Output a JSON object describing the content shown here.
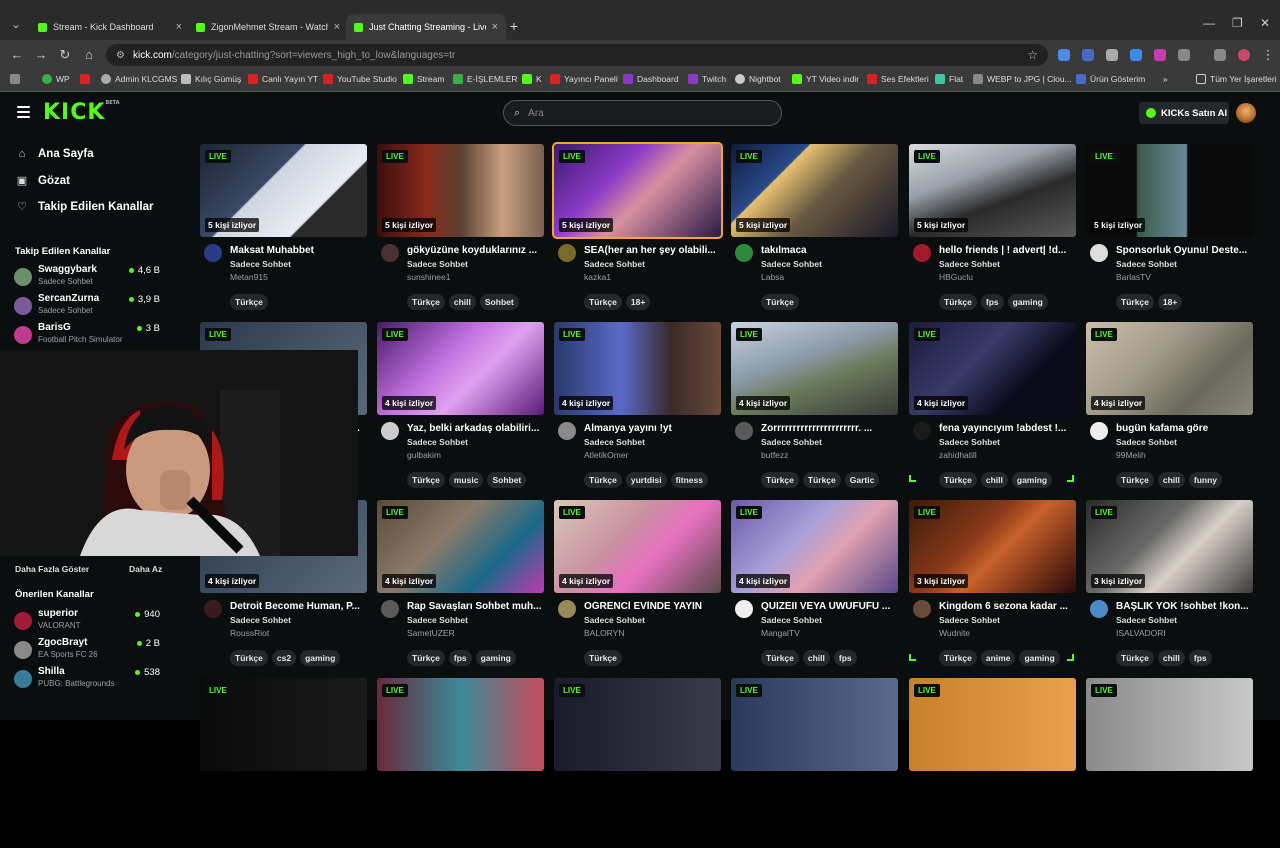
{
  "browser": {
    "tabs": [
      {
        "title": "Stream - Kick Dashboard"
      },
      {
        "title": "ZigonMehmet Stream - Watch"
      },
      {
        "title": "Just Chatting Streaming - Live"
      }
    ],
    "url_host": "kick.com",
    "url_path": "/category/just-chatting?sort=viewers_high_to_low&languages=tr",
    "bookmarks": [
      "WP",
      "Admin KLCGMS",
      "Kılıç Gümüş",
      "Canlı Yayın YT",
      "YouTube Studio",
      "Stream",
      "E-İŞLEMLER",
      "K",
      "Yayıncı Paneli",
      "Dashboard",
      "Twitch",
      "Nightbot",
      "YT Video indir",
      "Ses Efektleri",
      "Flat",
      "WEBP to JPG | Clou...",
      "Ürün Gösterim"
    ],
    "bookmarks_folder": "Tüm Yer İşaretleri"
  },
  "header": {
    "logo": "KICK",
    "logo_badge": "BETA",
    "search_placeholder": "Ara",
    "buy_label": "KICKs Satın Al"
  },
  "sidebar": {
    "nav": [
      "Ana Sayfa",
      "Gözat",
      "Takip Edilen Kanallar"
    ],
    "followed_heading": "Takip Edilen Kanallar",
    "followed": [
      {
        "name": "Swaggybark",
        "sub": "Sadece Sohbet",
        "viewers": "4,6 B",
        "color": "#6a8f6a"
      },
      {
        "name": "SercanZurna",
        "sub": "Sadece Sohbet",
        "viewers": "3,9 B",
        "color": "#7a5a9a"
      },
      {
        "name": "BarisG",
        "sub": "Football Pitch Simulator",
        "viewers": "3 B",
        "color": "#c23b8a"
      }
    ],
    "show_more": "Daha Fazla Göster",
    "show_less": "Daha Az",
    "recommended_heading": "Önerilen Kanallar",
    "recommended": [
      {
        "name": "superior",
        "sub": "VALORANT",
        "viewers": "940",
        "color": "#a01a3a"
      },
      {
        "name": "ZgocBrayt",
        "sub": "EA Sports FC 26",
        "viewers": "2 B",
        "color": "#888"
      },
      {
        "name": "Shilla",
        "sub": "PUBG: Battlegrounds",
        "viewers": "538",
        "color": "#3a7a9a"
      }
    ]
  },
  "live_label": "LIVE",
  "cards": [
    {
      "viewers": "5 kişi izliyor",
      "title": "Maksat Muhabbet",
      "category": "Sadece Sohbet",
      "channel": "Metan915",
      "tags": [
        "Türkçe"
      ],
      "thumb": "linear-gradient(135deg,#1c2430,#3a4a66 40%,#cfd6e0 41%,#e8ecf2 70%,#2a2a2a 71%)",
      "avatar": "#2a3a8a"
    },
    {
      "viewers": "5 kişi izliyor",
      "title": "gökyüzüne koyduklarınız ...",
      "category": "Sadece Sohbet",
      "channel": "sunshinee1",
      "tags": [
        "Türkçe",
        "chill",
        "Sohbet"
      ],
      "thumb": "linear-gradient(90deg,#3a0e0e,#8a2a1a 30%,#5a4030 50%,#c8a080 75%,#7a6050)",
      "avatar": "#4a3030"
    },
    {
      "viewers": "5 kişi izliyor",
      "title": "SEA(her an her şey olabili...",
      "category": "Sadece Sohbet",
      "channel": "kazka1",
      "tags": [
        "Türkçe",
        "18+"
      ],
      "thumb": "linear-gradient(135deg,#3a1a6a,#8a3ac8 35%,#d890a0 55%,#2a1a4a)",
      "avatar": "#7a6a2a",
      "selected": true
    },
    {
      "viewers": "5 kişi izliyor",
      "title": "takılmaca",
      "category": "Sadece Sohbet",
      "channel": "Labsa",
      "tags": [
        "Türkçe"
      ],
      "thumb": "linear-gradient(135deg,#0e1a3a,#2a4a8a 30%,#e8c070 31%,#6a5a40 55%,#1a1a2a)",
      "avatar": "#2a8a3a"
    },
    {
      "viewers": "5 kişi izliyor",
      "title": "hello friends | ! advert| !d...",
      "category": "Sadece Sohbet",
      "channel": "HBGuclu",
      "tags": [
        "Türkçe",
        "fps",
        "gaming"
      ],
      "thumb": "linear-gradient(160deg,#d8dce0,#9aa0a8 35%,#2a2a2a 60%,#5a5a5a)",
      "avatar": "#a01a2a"
    },
    {
      "viewers": "5 kişi izliyor",
      "title": "Sponsorluk Oyunu! Deste...",
      "category": "Sadece Sohbet",
      "channel": "BarlasTV",
      "tags": [
        "Türkçe",
        "18+"
      ],
      "thumb": "linear-gradient(90deg,#0a0a0a 30%,#3a5a4a 31%,#6a8a9a 60%,#0a0a0a 61%)",
      "avatar": "#ddd"
    },
    {
      "viewers": "4 kişi izliyor",
      "title": "Detroit Become Human, P...",
      "category": "Sadece Sohbet",
      "channel": "RoussRiot",
      "tags": [
        "Türkçe",
        "cs2",
        "gaming"
      ],
      "thumb": "linear-gradient(135deg,#2a3a4a,#5a6a7a)",
      "avatar": "#3a1a1a"
    },
    {
      "viewers": "4 kişi izliyor",
      "title": "Yaz, belki arkadaş olabiliri...",
      "category": "Sadece Sohbet",
      "channel": "gulbakim",
      "tags": [
        "Türkçe",
        "music",
        "Sohbet"
      ],
      "thumb": "linear-gradient(135deg,#4a1a6a,#c070e0 40%,#e0a0f0 60%,#5a1a7a)",
      "avatar": "#ccc"
    },
    {
      "viewers": "4 kişi izliyor",
      "title": "Almanya yayını !yt",
      "category": "Sadece Sohbet",
      "channel": "AtletikOmer",
      "tags": [
        "Türkçe",
        "yurtdisi",
        "fitness"
      ],
      "thumb": "linear-gradient(90deg,#2a3a6a,#5a6ac8 40%,#3a2a2a 70%,#6a4a3a)",
      "avatar": "#8a8a8a"
    },
    {
      "viewers": "4 kişi izliyor",
      "title": "Zorrrrrrrrrrrrrrrrrrrrrr. ...",
      "category": "Sadece Sohbet",
      "channel": "butfezz",
      "tags": [
        "Türkçe",
        "Türkçe",
        "Gartic"
      ],
      "thumb": "linear-gradient(160deg,#c8d4e0,#8a9aa8 40%,#6a7a5a 60%,#3a3a3a)",
      "avatar": "#5a5a5a"
    },
    {
      "viewers": "4 kişi izliyor",
      "title": "fena yayıncıyım !abdest !...",
      "category": "Sadece Sohbet",
      "channel": "zahidhatill",
      "tags": [
        "Türkçe",
        "chill",
        "gaming"
      ],
      "thumb": "linear-gradient(135deg,#1a1a3a,#3a3a6a 40%,#0a0a1a 70%)",
      "avatar": "#1a1a1a"
    },
    {
      "viewers": "4 kişi izliyor",
      "title": "bugün kafama göre",
      "category": "Sadece Sohbet",
      "channel": "99Melih",
      "tags": [
        "Türkçe",
        "chill",
        "funny"
      ],
      "thumb": "linear-gradient(135deg,#c8c0a8,#a09a88 40%,#6a6a5a 70%,#8a8a7a)",
      "avatar": "#eee"
    },
    {
      "viewers": "4 kişi izliyor",
      "title": "Detroit Become Human, P...",
      "category": "Sadece Sohbet",
      "channel": "RoussRiot",
      "tags": [
        "Türkçe",
        "cs2",
        "gaming"
      ],
      "thumb": "linear-gradient(135deg,#2a3a4a,#5a6a7a)",
      "avatar": "#3a1a1a"
    },
    {
      "viewers": "4 kişi izliyor",
      "title": "Rap Savaşları Sohbet muh...",
      "category": "Sadece Sohbet",
      "channel": "SametUZER",
      "tags": [
        "Türkçe",
        "fps",
        "gaming"
      ],
      "thumb": "linear-gradient(135deg,#5a4a3a,#8a7a6a 40%,#1a6a8a 70%,#c03ab0)",
      "avatar": "#5a5a5a"
    },
    {
      "viewers": "4 kişi izliyor",
      "title": "ÖĞRENCİ EVİNDE YAYIN",
      "category": "Sadece Sohbet",
      "channel": "BALORYN",
      "tags": [
        "Türkçe"
      ],
      "thumb": "linear-gradient(135deg,#d8c8b8,#c890a0 40%,#e870c0 60%,#5a4a4a)",
      "avatar": "#9a8a5a"
    },
    {
      "viewers": "4 kişi izliyor",
      "title": "QUIZEII VEYA UWUFUFU ...",
      "category": "Sadece Sohbet",
      "channel": "MangalTV",
      "tags": [
        "Türkçe",
        "chill",
        "fps"
      ],
      "thumb": "linear-gradient(135deg,#6a5aa8,#a8a0d8 40%,#e0a0b0 60%,#5a4a8a)",
      "avatar": "#eee"
    },
    {
      "viewers": "3 kişi izliyor",
      "title": "Kingdom 6 sezona kadar ...",
      "category": "Sadece Sohbet",
      "channel": "Wudnite",
      "tags": [
        "Türkçe",
        "anime",
        "gaming"
      ],
      "thumb": "linear-gradient(135deg,#3a1a0a,#8a3a1a 40%,#c8602a 55%,#2a0a0a)",
      "avatar": "#6a4a3a"
    },
    {
      "viewers": "3 kişi izliyor",
      "title": "BAŞLIK YOK !sohbet !kon...",
      "category": "Sadece Sohbet",
      "channel": "ISALVADORI",
      "tags": [
        "Türkçe",
        "chill",
        "fps"
      ],
      "thumb": "linear-gradient(135deg,#2a2a2a,#6a6a6a 40%,#d8d0c8 60%,#3a3a3a)",
      "avatar": "#4a8ac8"
    },
    {
      "viewers": "",
      "title": "",
      "category": "",
      "channel": "",
      "tags": [],
      "thumb": "linear-gradient(90deg,#0a0a0a,#1a1a1a)",
      "avatar": "#000"
    },
    {
      "viewers": "",
      "title": "",
      "category": "",
      "channel": "",
      "tags": [],
      "thumb": "linear-gradient(90deg,#6a2a3a,#3a8a9a 50%,#c84a5a)",
      "avatar": "#000"
    },
    {
      "viewers": "",
      "title": "",
      "category": "",
      "channel": "",
      "tags": [],
      "thumb": "linear-gradient(90deg,#1a1a2a,#3a3a4a)",
      "avatar": "#000"
    },
    {
      "viewers": "",
      "title": "",
      "category": "",
      "channel": "",
      "tags": [],
      "thumb": "linear-gradient(90deg,#2a3a5a,#5a6a8a)",
      "avatar": "#000"
    },
    {
      "viewers": "",
      "title": "",
      "category": "",
      "channel": "",
      "tags": [],
      "thumb": "linear-gradient(90deg,#c8802a,#e8a04a)",
      "avatar": "#000"
    },
    {
      "viewers": "",
      "title": "",
      "category": "",
      "channel": "",
      "tags": [],
      "thumb": "linear-gradient(90deg,#8a8a8a,#c8c8c8)",
      "avatar": "#000"
    }
  ],
  "colors": {
    "brand": "#53fc18",
    "bg": "#0b0e0f",
    "selected_outline": "#f5a623"
  }
}
